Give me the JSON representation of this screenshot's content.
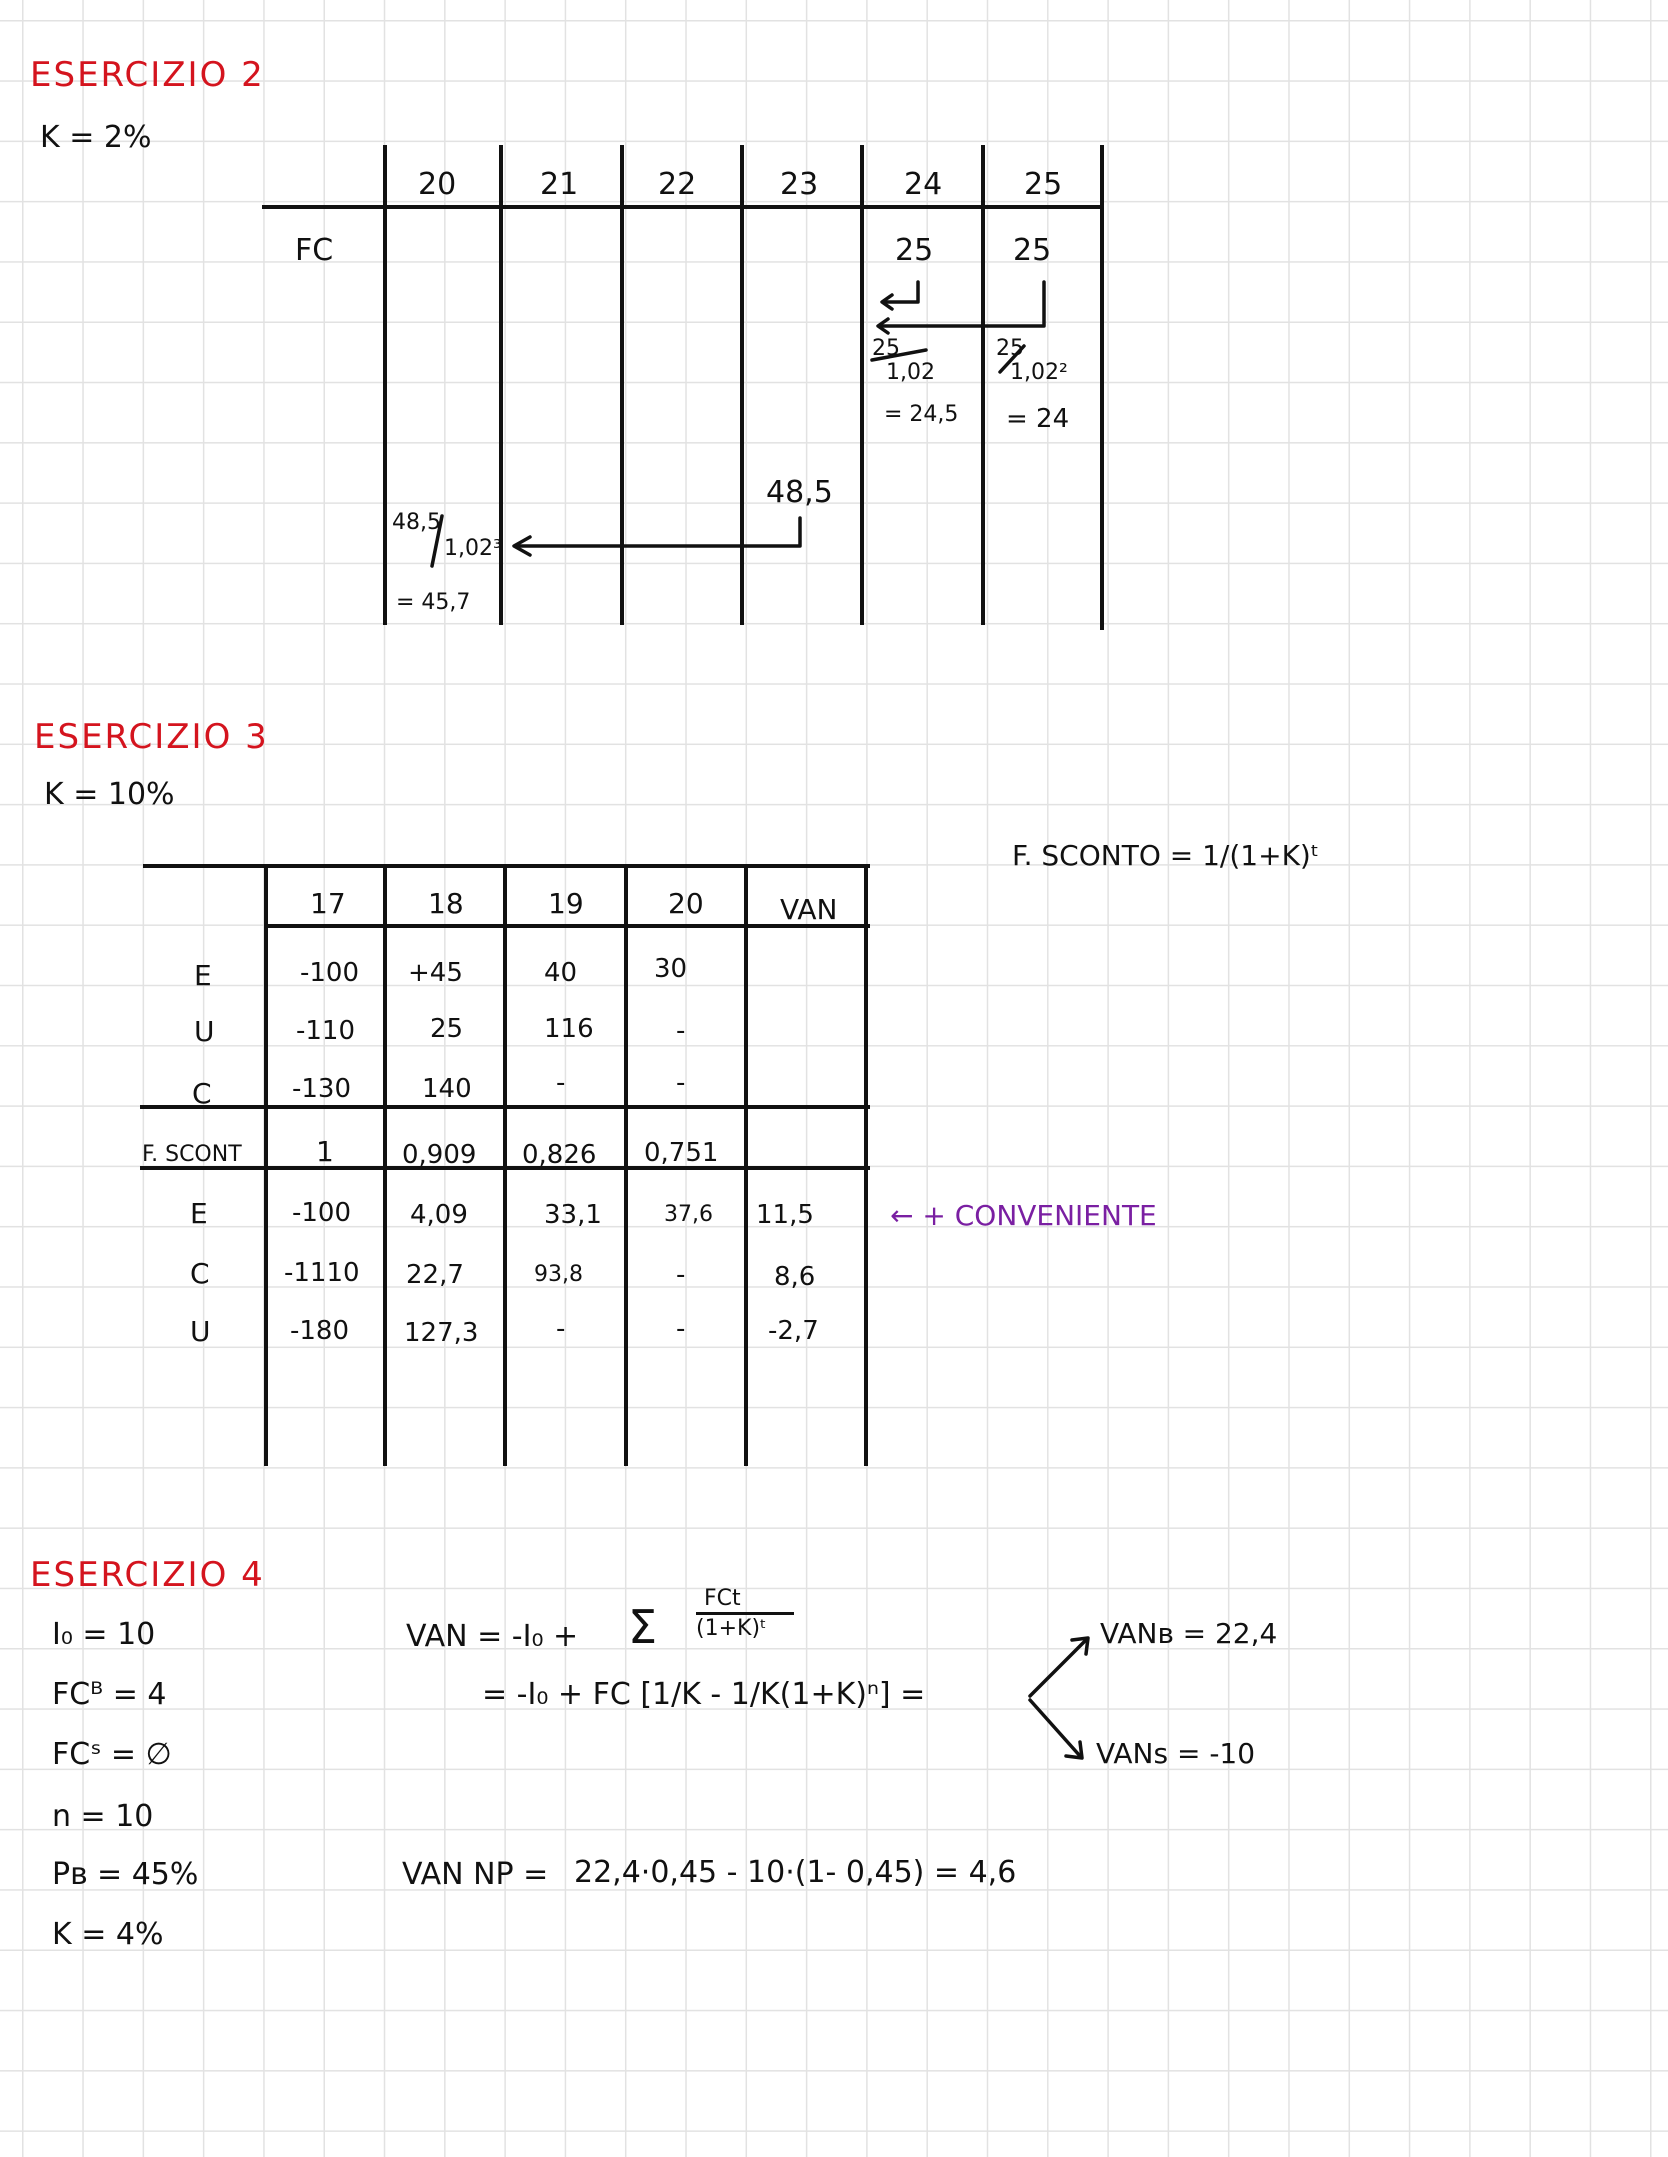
{
  "colors": {
    "title": "#d4141e",
    "ink": "#111111",
    "highlight": "#7a1fa2",
    "grid": "#e2e2e2"
  },
  "ex2": {
    "title": "ESERCIZIO 2",
    "k": "K = 2%",
    "years": [
      "20",
      "21",
      "22",
      "23",
      "24",
      "25"
    ],
    "row_label": "FC",
    "fc24": "25",
    "fc25": "25",
    "calc24_num": "25",
    "calc24_den": "1,02",
    "calc24_res": "= 24,5",
    "calc25_num": "25",
    "calc25_den": "1,02²",
    "calc25_res": "= 24",
    "val23": "48,5",
    "calc20_num": "48,5",
    "calc20_den": "1,02³",
    "calc20_res": "= 45,7"
  },
  "ex3": {
    "title": "ESERCIZIO 3",
    "k": "K = 10%",
    "discount_formula": "F. SCONTO = 1/(1+K)ᵗ",
    "headers": [
      "17",
      "18",
      "19",
      "20",
      "VAN"
    ],
    "rows": [
      {
        "label": "E",
        "cells": [
          "-100",
          "+45",
          "40",
          "30",
          ""
        ]
      },
      {
        "label": "U",
        "cells": [
          "-110",
          "25",
          "116",
          "-",
          ""
        ]
      },
      {
        "label": "C",
        "cells": [
          "-130",
          "140",
          "-",
          "-",
          ""
        ]
      },
      {
        "label": "F. SCONT",
        "cells": [
          "1",
          "0,909",
          "0,826",
          "0,751",
          ""
        ]
      },
      {
        "label": "E",
        "cells": [
          "-100",
          "4,09",
          "33,1",
          "37,6",
          "11,5"
        ]
      },
      {
        "label": "C",
        "cells": [
          "-1110",
          "22,7",
          "93,8",
          "-",
          "8,6"
        ]
      },
      {
        "label": "U",
        "cells": [
          "-180",
          "127,3",
          "-",
          "-",
          "-2,7"
        ]
      }
    ],
    "note": "← + CONVENIENTE"
  },
  "ex4": {
    "title": "ESERCIZIO 4",
    "given": [
      "I₀ = 10",
      "FCᴮ = 4",
      "FCˢ = ∅",
      "n = 10",
      "Pʙ = 45%",
      "K = 4%"
    ],
    "van_line1_left": "VAN = -I₀ +",
    "sum_symbol": "Σ",
    "frac_num": "FCt",
    "frac_den": "(1+K)ᵗ",
    "van_line2": "= -I₀ + FC [1/K - 1/K(1+K)ⁿ] =",
    "van_b": "VANʙ = 22,4",
    "van_s": "VANs = -10",
    "van_np_label": "VAN NP =",
    "van_np_expr": "22,4·0,45 - 10·(1- 0,45) = 4,6"
  }
}
